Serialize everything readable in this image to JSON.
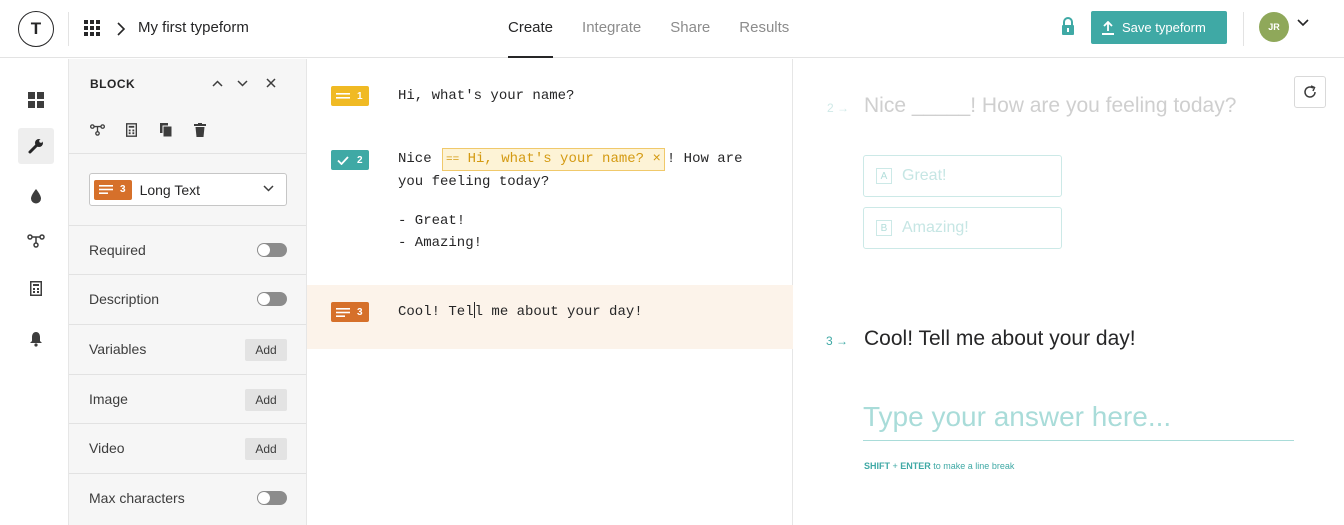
{
  "app": {
    "logo_letter": "T",
    "breadcrumb_title": "My first typeform",
    "tabs": [
      {
        "label": "Create",
        "active": true
      },
      {
        "label": "Integrate",
        "active": false
      },
      {
        "label": "Share",
        "active": false
      },
      {
        "label": "Results",
        "active": false
      }
    ],
    "save_label": "Save typeform",
    "avatar_initials": "JR",
    "accent_color": "#3fa9a5"
  },
  "rail": {
    "items": [
      "grid-icon",
      "wrench-icon",
      "drop-icon",
      "logic-icon",
      "calculator-icon",
      "bell-icon"
    ],
    "active": "wrench-icon"
  },
  "panel": {
    "title": "BLOCK",
    "tools": [
      "logic-jump-icon",
      "calculator-icon",
      "duplicate-icon",
      "trash-icon"
    ],
    "type_select": {
      "number": "3",
      "label": "Long Text"
    },
    "options": [
      {
        "label": "Required",
        "control": "toggle",
        "on": false
      },
      {
        "label": "Description",
        "control": "toggle",
        "on": false
      },
      {
        "label": "Variables",
        "control": "add",
        "button": "Add"
      },
      {
        "label": "Image",
        "control": "add",
        "button": "Add"
      },
      {
        "label": "Video",
        "control": "add",
        "button": "Add"
      },
      {
        "label": "Max characters",
        "control": "toggle",
        "on": false
      }
    ]
  },
  "editor": {
    "questions": [
      {
        "number": "1",
        "type": "short-text",
        "text": "Hi, what's your name?"
      },
      {
        "number": "2",
        "type": "multiple-choice",
        "text_before": "Nice",
        "recall": "Hi, what's your name?",
        "text_after": "! How are",
        "text_line2": "you feeling today?",
        "choices": [
          "- Great!",
          "- Amazing!"
        ]
      },
      {
        "number": "3",
        "type": "long-text",
        "text_a": "Cool! Tel",
        "text_b": "l me about your day!",
        "selected": true
      }
    ]
  },
  "preview": {
    "q2_number": "2",
    "q2_text": "Nice _____! How are you feeling today?",
    "q2_choices": [
      {
        "key": "A",
        "label": "Great!"
      },
      {
        "key": "B",
        "label": "Amazing!"
      }
    ],
    "q3_number": "3",
    "q3_text": "Cool! Tell me about your day!",
    "answer_placeholder": "Type your answer here...",
    "hint_key1": "SHIFT",
    "hint_plus": " + ",
    "hint_key2": "ENTER",
    "hint_text": " to make a line break",
    "arrow": "→"
  }
}
